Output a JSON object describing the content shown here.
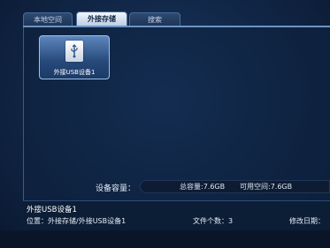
{
  "tabs": [
    {
      "label": "本地空间",
      "active": false
    },
    {
      "label": "外接存储",
      "active": true
    },
    {
      "label": "搜索",
      "active": false
    }
  ],
  "device": {
    "label": "外接USB设备1",
    "icon": "usb-drive-icon"
  },
  "capacity": {
    "label": "设备容量：",
    "total": "总容量:7.6GB",
    "free": "可用空间:7.6GB"
  },
  "info": {
    "name": "外接USB设备1",
    "location": "位置：外接存储/外接USB设备1",
    "file_count": "文件个数：3",
    "modified_label": "修改日期："
  },
  "colors": {
    "accent": "#6f92c2",
    "active_tab": "#f2f6fb",
    "background": "#12294b"
  }
}
